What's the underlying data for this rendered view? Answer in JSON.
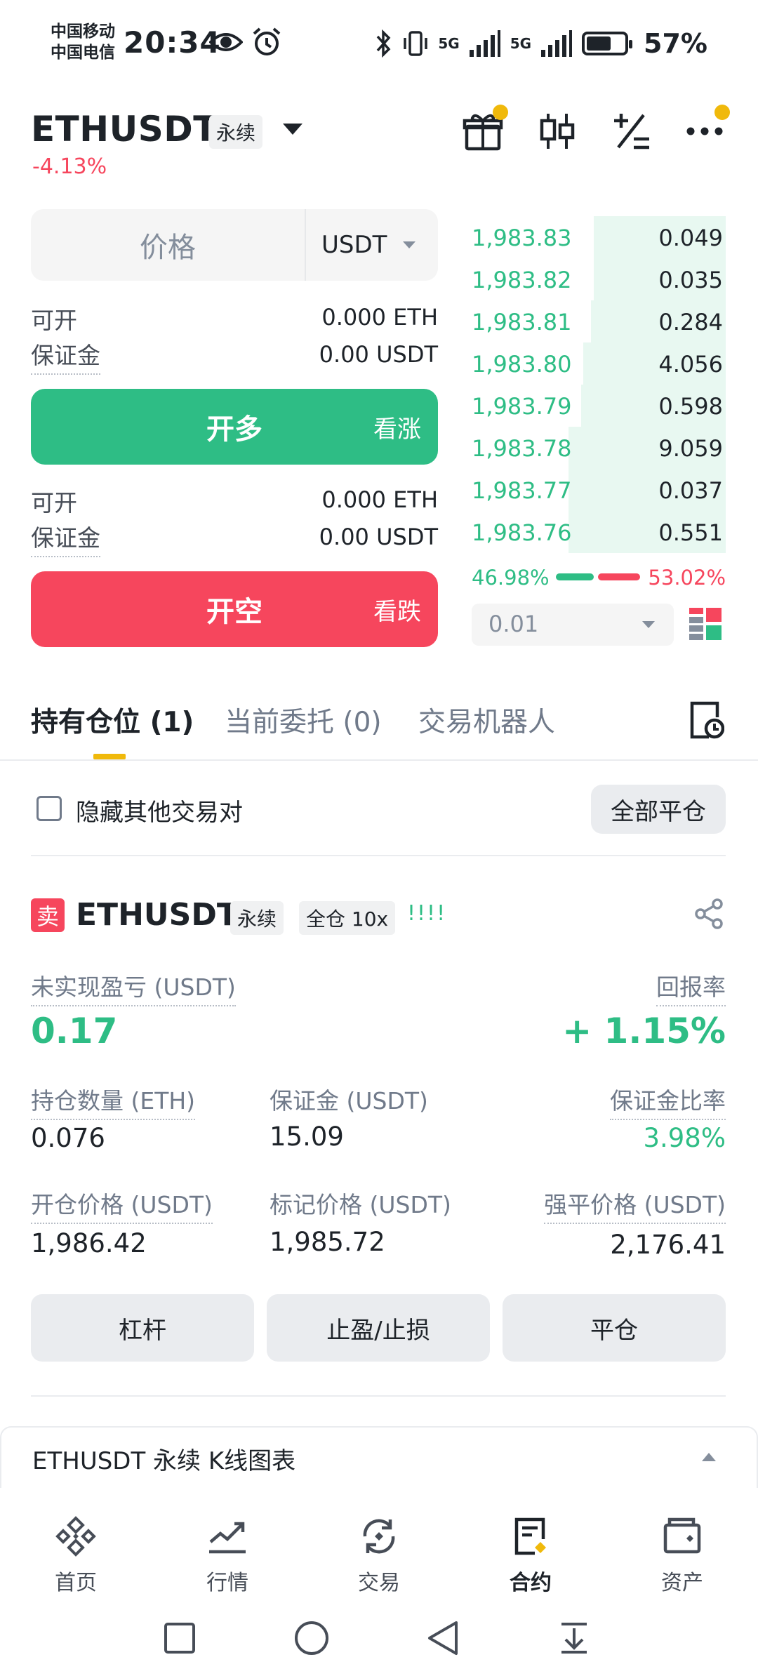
{
  "status_bar": {
    "carrier1": "中国移动",
    "carrier2": "中国电信",
    "time": "20:34",
    "net1": "5G",
    "net2": "5G",
    "battery": "57%"
  },
  "header": {
    "symbol": "ETHUSDT",
    "contract_tag": "永续",
    "change": "-4.13%"
  },
  "order_form": {
    "price_placeholder": "价格",
    "price_unit": "USDT",
    "long": {
      "avail_label": "可开",
      "avail_value": "0.000 ETH",
      "margin_label": "保证金",
      "margin_value": "0.00 USDT",
      "button": "开多",
      "button_sub": "看涨"
    },
    "short": {
      "avail_label": "可开",
      "avail_value": "0.000 ETH",
      "margin_label": "保证金",
      "margin_value": "0.00 USDT",
      "button": "开空",
      "button_sub": "看跌"
    }
  },
  "order_book": {
    "bids": [
      {
        "price": "1,983.83",
        "qty": "0.049",
        "depth": 0.52
      },
      {
        "price": "1,983.82",
        "qty": "0.035",
        "depth": 0.52
      },
      {
        "price": "1,983.81",
        "qty": "0.284",
        "depth": 0.53
      },
      {
        "price": "1,983.80",
        "qty": "4.056",
        "depth": 0.56
      },
      {
        "price": "1,983.79",
        "qty": "0.598",
        "depth": 0.57
      },
      {
        "price": "1,983.78",
        "qty": "9.059",
        "depth": 0.62
      },
      {
        "price": "1,983.77",
        "qty": "0.037",
        "depth": 0.62
      },
      {
        "price": "1,983.76",
        "qty": "0.551",
        "depth": 0.62
      }
    ],
    "buy_ratio": "46.98%",
    "sell_ratio": "53.02%",
    "buy_ratio_value": 46.98,
    "step": "0.01"
  },
  "tabs": [
    {
      "label": "持有仓位 (1)"
    },
    {
      "label": "当前委托 (0)"
    },
    {
      "label": "交易机器人"
    }
  ],
  "filter": {
    "hide_others": "隐藏其他交易对",
    "close_all": "全部平仓"
  },
  "position": {
    "side": "卖",
    "symbol": "ETHUSDT",
    "contract_tag": "永续",
    "margin_tag": "全仓 10x",
    "risk": "!!!!",
    "pnl_label": "未实现盈亏 (USDT)",
    "pnl_value": "0.17",
    "roe_label": "回报率",
    "roe_value": "+ 1.15%",
    "size_label": "持仓数量 (ETH)",
    "size_value": "0.076",
    "margin_label": "保证金 (USDT)",
    "margin_value": "15.09",
    "margin_ratio_label": "保证金比率",
    "margin_ratio_value": "3.98%",
    "entry_label": "开仓价格 (USDT)",
    "entry_value": "1,986.42",
    "mark_label": "标记价格 (USDT)",
    "mark_value": "1,985.72",
    "liq_label": "强平价格 (USDT)",
    "liq_value": "2,176.41",
    "actions": [
      "杠杆",
      "止盈/止损",
      "平仓"
    ]
  },
  "kline_panel": {
    "title": "ETHUSDT 永续 K线图表"
  },
  "bottom_nav": [
    {
      "label": "首页",
      "icon": "binance-logo-icon"
    },
    {
      "label": "行情",
      "icon": "chart-trend-icon"
    },
    {
      "label": "交易",
      "icon": "trade-swap-icon"
    },
    {
      "label": "合约",
      "icon": "futures-doc-icon"
    },
    {
      "label": "资产",
      "icon": "wallet-icon"
    }
  ],
  "colors": {
    "green": "#2ebd85",
    "red": "#f6465d",
    "brand": "#f0b90b"
  }
}
